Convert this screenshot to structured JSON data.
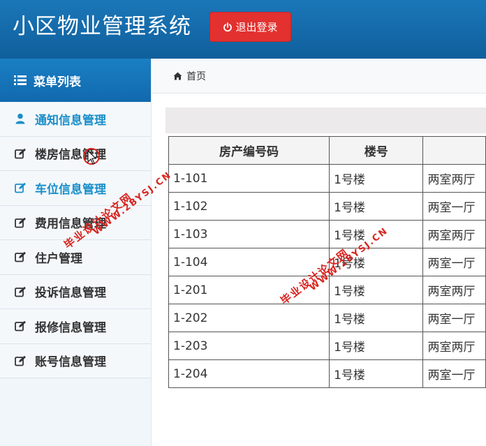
{
  "header": {
    "title": "小区物业管理系统",
    "logout_label": "退出登录"
  },
  "sidebar": {
    "title": "菜单列表",
    "items": [
      {
        "label": "通知信息管理",
        "icon": "user-icon",
        "active": true
      },
      {
        "label": "楼房信息管理",
        "icon": "edit-icon",
        "active": false
      },
      {
        "label": "车位信息管理",
        "icon": "edit-icon",
        "active": true
      },
      {
        "label": "费用信息管理",
        "icon": "edit-icon",
        "active": false
      },
      {
        "label": "住户管理",
        "icon": "edit-icon",
        "active": false
      },
      {
        "label": "投诉信息管理",
        "icon": "edit-icon",
        "active": false
      },
      {
        "label": "报修信息管理",
        "icon": "edit-icon",
        "active": false
      },
      {
        "label": "账号信息管理",
        "icon": "edit-icon",
        "active": false
      }
    ]
  },
  "breadcrumb": {
    "home_label": "首页"
  },
  "table": {
    "headers": [
      "房产编号码",
      "楼号",
      ""
    ],
    "rows": [
      [
        "1-101",
        "1号楼",
        "两室两厅"
      ],
      [
        "1-102",
        "1号楼",
        "两室一厅"
      ],
      [
        "1-103",
        "1号楼",
        "两室两厅"
      ],
      [
        "1-104",
        "1号楼",
        "两室一厅"
      ],
      [
        "1-201",
        "1号楼",
        "两室两厅"
      ],
      [
        "1-202",
        "1号楼",
        "两室一厅"
      ],
      [
        "1-203",
        "1号楼",
        "两室两厅"
      ],
      [
        "1-204",
        "1号楼",
        "两室一厅"
      ]
    ]
  },
  "watermarks": {
    "line1": "毕业设计论文网",
    "line2": "WWW.2BYSJ.CN"
  },
  "colors": {
    "header_bg": "#1b77b8",
    "logout_bg": "#e2312f",
    "active_nav": "#1a8fc9",
    "watermark": "#d9241f"
  }
}
